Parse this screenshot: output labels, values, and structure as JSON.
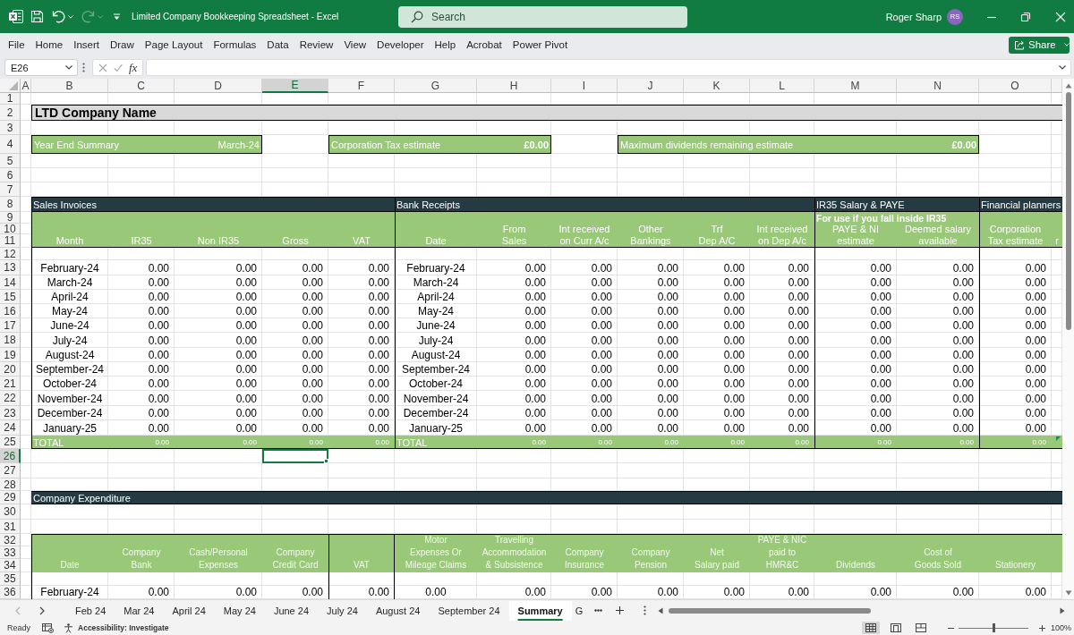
{
  "title_bar": {
    "quick_access": [
      {
        "kind": "save",
        "disabled": false
      },
      {
        "kind": "undo",
        "disabled": false
      },
      {
        "kind": "redo",
        "disabled": true
      }
    ],
    "title": "Limited Company Bookkeeping Spreadsheet - Excel",
    "search": {
      "placeholder": "Search"
    },
    "user": {
      "name": "Roger Sharp",
      "initials": "RS"
    }
  },
  "ribbon": {
    "tabs": [
      "File",
      "Home",
      "Insert",
      "Draw",
      "Page Layout",
      "Formulas",
      "Data",
      "Review",
      "View",
      "Developer",
      "Help",
      "Acrobat",
      "Power Pivot"
    ],
    "share_button": "Share"
  },
  "formula_bar": {
    "name_box": "E26",
    "function_button": "fx"
  },
  "sheet": {
    "columns": [
      {
        "label": "A",
        "selected": false
      },
      {
        "label": "B",
        "selected": false
      },
      {
        "label": "C",
        "selected": false
      },
      {
        "label": "D",
        "selected": false
      },
      {
        "label": "E",
        "selected": true
      },
      {
        "label": "F",
        "selected": false
      },
      {
        "label": "G",
        "selected": false
      },
      {
        "label": "H",
        "selected": false
      },
      {
        "label": "I",
        "selected": false
      },
      {
        "label": "J",
        "selected": false
      },
      {
        "label": "K",
        "selected": false
      },
      {
        "label": "L",
        "selected": false
      },
      {
        "label": "M",
        "selected": false
      },
      {
        "label": "N",
        "selected": false
      },
      {
        "label": "O",
        "selected": false
      }
    ],
    "rows": [
      {
        "label": "1",
        "selected": false
      },
      {
        "label": "2",
        "selected": false
      },
      {
        "label": "3",
        "selected": false
      },
      {
        "label": "4",
        "selected": false
      },
      {
        "label": "5",
        "selected": false
      },
      {
        "label": "6",
        "selected": false
      },
      {
        "label": "7",
        "selected": false
      },
      {
        "label": "8",
        "selected": false
      },
      {
        "label": "9",
        "selected": false
      },
      {
        "label": "10",
        "selected": false
      },
      {
        "label": "11",
        "selected": false
      },
      {
        "label": "12",
        "selected": false
      },
      {
        "label": "13",
        "selected": false
      },
      {
        "label": "14",
        "selected": false
      },
      {
        "label": "15",
        "selected": false
      },
      {
        "label": "16",
        "selected": false
      },
      {
        "label": "17",
        "selected": false
      },
      {
        "label": "18",
        "selected": false
      },
      {
        "label": "19",
        "selected": false
      },
      {
        "label": "20",
        "selected": false
      },
      {
        "label": "21",
        "selected": false
      },
      {
        "label": "22",
        "selected": false
      },
      {
        "label": "23",
        "selected": false
      },
      {
        "label": "24",
        "selected": false
      },
      {
        "label": "25",
        "selected": false
      },
      {
        "label": "26",
        "selected": true
      },
      {
        "label": "27",
        "selected": false
      },
      {
        "label": "28",
        "selected": false
      },
      {
        "label": "29",
        "selected": false
      },
      {
        "label": "30",
        "selected": false
      },
      {
        "label": "31",
        "selected": false
      },
      {
        "label": "32",
        "selected": false
      },
      {
        "label": "33",
        "selected": false
      },
      {
        "label": "34",
        "selected": false
      },
      {
        "label": "35",
        "selected": false
      },
      {
        "label": "36",
        "selected": false
      }
    ],
    "company_name": "LTD Company Name",
    "summary_boxes": [
      {
        "label": "Year End Summary",
        "value": "March-24",
        "kind": "date"
      },
      {
        "label": "Corporation Tax estimate",
        "value": "£0.00",
        "kind": "currency"
      },
      {
        "label": "Maximum dividends remaining estimate",
        "value": "£0.00",
        "kind": "currency"
      }
    ],
    "sections": [
      {
        "title": "Sales Invoices"
      },
      {
        "title": "Bank Receipts"
      },
      {
        "title": "IR35 Salary & PAYE",
        "note": "For use if you fall inside IR35"
      },
      {
        "title": "Financial planners"
      }
    ],
    "column_headings": [
      "Month",
      "IR35",
      "Non IR35",
      "Gross",
      "VAT",
      "Date",
      "From\nSales",
      "Int received\non Curr A/c",
      "Other\nBankings",
      "Trf\nDep A/C",
      "Int received\non Dep A/c",
      "PAYE & NI\nestimate",
      "Deemed salary\navailable",
      "Corporation\nTax estimate",
      "r"
    ],
    "entries": [
      [
        "February-24",
        "0.00",
        "0.00",
        "0.00",
        "0.00",
        "February-24",
        "0.00",
        "0.00",
        "0.00",
        "0.00",
        "0.00",
        "0.00",
        "0.00",
        "0.00"
      ],
      [
        "March-24",
        "0.00",
        "0.00",
        "0.00",
        "0.00",
        "March-24",
        "0.00",
        "0.00",
        "0.00",
        "0.00",
        "0.00",
        "0.00",
        "0.00",
        "0.00"
      ],
      [
        "April-24",
        "0.00",
        "0.00",
        "0.00",
        "0.00",
        "April-24",
        "0.00",
        "0.00",
        "0.00",
        "0.00",
        "0.00",
        "0.00",
        "0.00",
        "0.00"
      ],
      [
        "May-24",
        "0.00",
        "0.00",
        "0.00",
        "0.00",
        "May-24",
        "0.00",
        "0.00",
        "0.00",
        "0.00",
        "0.00",
        "0.00",
        "0.00",
        "0.00"
      ],
      [
        "June-24",
        "0.00",
        "0.00",
        "0.00",
        "0.00",
        "June-24",
        "0.00",
        "0.00",
        "0.00",
        "0.00",
        "0.00",
        "0.00",
        "0.00",
        "0.00"
      ],
      [
        "July-24",
        "0.00",
        "0.00",
        "0.00",
        "0.00",
        "July-24",
        "0.00",
        "0.00",
        "0.00",
        "0.00",
        "0.00",
        "0.00",
        "0.00",
        "0.00"
      ],
      [
        "August-24",
        "0.00",
        "0.00",
        "0.00",
        "0.00",
        "August-24",
        "0.00",
        "0.00",
        "0.00",
        "0.00",
        "0.00",
        "0.00",
        "0.00",
        "0.00"
      ],
      [
        "September-24",
        "0.00",
        "0.00",
        "0.00",
        "0.00",
        "September-24",
        "0.00",
        "0.00",
        "0.00",
        "0.00",
        "0.00",
        "0.00",
        "0.00",
        "0.00"
      ],
      [
        "October-24",
        "0.00",
        "0.00",
        "0.00",
        "0.00",
        "October-24",
        "0.00",
        "0.00",
        "0.00",
        "0.00",
        "0.00",
        "0.00",
        "0.00",
        "0.00"
      ],
      [
        "November-24",
        "0.00",
        "0.00",
        "0.00",
        "0.00",
        "November-24",
        "0.00",
        "0.00",
        "0.00",
        "0.00",
        "0.00",
        "0.00",
        "0.00",
        "0.00"
      ],
      [
        "December-24",
        "0.00",
        "0.00",
        "0.00",
        "0.00",
        "December-24",
        "0.00",
        "0.00",
        "0.00",
        "0.00",
        "0.00",
        "0.00",
        "0.00",
        "0.00"
      ],
      [
        "January-25",
        "0.00",
        "0.00",
        "0.00",
        "0.00",
        "January-25",
        "0.00",
        "0.00",
        "0.00",
        "0.00",
        "0.00",
        "0.00",
        "0.00",
        "0.00"
      ]
    ],
    "totals": [
      "TOTAL",
      "0.00",
      "0.00",
      "0.00",
      "0.00",
      "TOTAL",
      "0.00",
      "0.00",
      "0.00",
      "0.00",
      "0.00",
      "0.00",
      "0.00",
      "0.00"
    ],
    "expenditure": {
      "title": "Company Expenditure",
      "column_headings": [
        "Date",
        "Company\nBank",
        "Cash/Personal\nExpenses",
        "Company\nCredit Card",
        "VAT",
        "Motor\nExpenses Or\nMileage Claims",
        "Travelling\nAccommodation\n& Subsistence",
        "Company\nInsurance",
        "Company\nPension",
        "Net\nSalary paid",
        "PAYE & NIC\npaid to\nHMR&C",
        "Dividends",
        "Cost of\nGoods Sold",
        "Stationery"
      ],
      "entries": [
        [
          "February-24",
          "0.00",
          "0.00",
          "0.00",
          "0.00",
          "0.00",
          "0.00",
          "0.00",
          "0.00",
          "0.00",
          "0.00",
          "0.00",
          "0.00",
          "0.00"
        ]
      ]
    }
  },
  "sheet_tabs": {
    "navigation": [
      {
        "kind": "previous",
        "disabled": true
      },
      {
        "kind": "next",
        "disabled": false
      }
    ],
    "tabs": [
      {
        "label": "Feb 24",
        "selected": false
      },
      {
        "label": "Mar 24",
        "selected": false
      },
      {
        "label": "April 24",
        "selected": false
      },
      {
        "label": "May 24",
        "selected": false
      },
      {
        "label": "June 24",
        "selected": false
      },
      {
        "label": "July 24",
        "selected": false
      },
      {
        "label": "August 24",
        "selected": false
      },
      {
        "label": "September 24",
        "selected": false
      },
      {
        "label": "Summary",
        "selected": true
      },
      {
        "label": "G",
        "selected": false
      }
    ]
  },
  "status_bar": {
    "mode": "Ready",
    "accessibility": "Accessibility: Investigate",
    "views": [
      {
        "kind": "normal",
        "selected": true
      },
      {
        "kind": "page_layout",
        "selected": false
      },
      {
        "kind": "page_break_preview",
        "selected": false
      }
    ],
    "zoom": {
      "level": 0.5,
      "reading": "100%"
    }
  }
}
